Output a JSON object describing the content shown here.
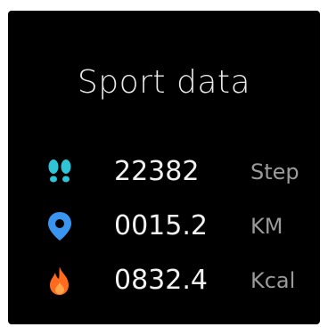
{
  "screen": {
    "title": "Sport data"
  },
  "rows": [
    {
      "icon": "footprints-icon",
      "value": "22382",
      "unit": "Step",
      "color": "#2ec6d6"
    },
    {
      "icon": "location-pin-icon",
      "value": "0015.2",
      "unit": "KM",
      "color": "#3a95f0"
    },
    {
      "icon": "flame-icon",
      "value": "0832.4",
      "unit": "Kcal",
      "color": "#ff6a1f"
    }
  ]
}
